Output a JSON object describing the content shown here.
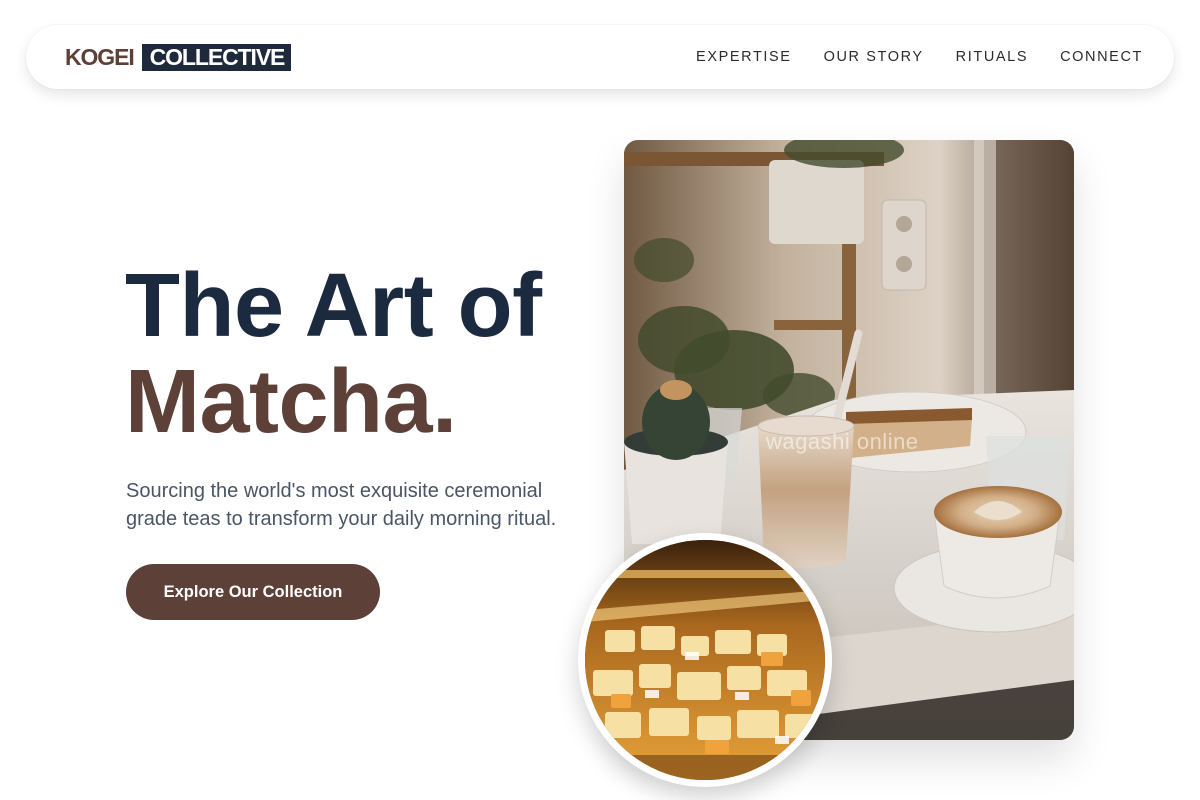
{
  "brand": {
    "logo_part1": "KOGEI",
    "logo_part2": "COLLECTIVE"
  },
  "nav": {
    "links": [
      "EXPERTISE",
      "OUR STORY",
      "RITUALS",
      "CONNECT"
    ]
  },
  "hero": {
    "title_line1": "The Art of",
    "title_line2": "Matcha.",
    "subtitle": "Sourcing the world's most exquisite ceremonial grade teas to transform your daily morning ritual.",
    "cta_label": "Explore Our Collection"
  },
  "images": {
    "main_photo_watermark": "wagashi online",
    "main_photo_subject": "cafe-table-with-latte-cake-and-cactus",
    "inset_photo_subject": "illuminated-cheese-display-case"
  },
  "colors": {
    "navy": "#1b2a3f",
    "brown": "#5d4037",
    "body_text": "#4a5566",
    "background": "#ffffff"
  }
}
